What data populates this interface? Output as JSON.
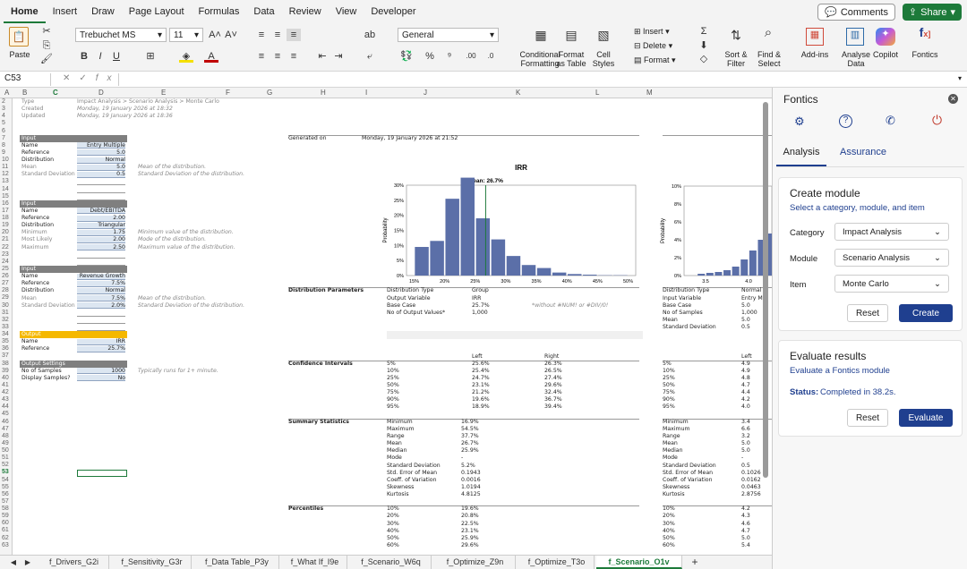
{
  "menu": {
    "items": [
      "Home",
      "Insert",
      "Draw",
      "Page Layout",
      "Formulas",
      "Data",
      "Review",
      "View",
      "Developer"
    ],
    "comments": "Comments",
    "share": "Share"
  },
  "ribbon": {
    "paste": "Paste",
    "font": "Trebuchet MS",
    "size": "11",
    "number_format": "General",
    "insert": "Insert",
    "delete": "Delete",
    "format": "Format",
    "conditional": [
      "Conditional",
      "Formatting"
    ],
    "format_table": [
      "Format",
      "as Table"
    ],
    "cell_styles": [
      "Cell",
      "Styles"
    ],
    "sort": [
      "Sort &",
      "Filter"
    ],
    "find": [
      "Find &",
      "Select"
    ],
    "addins": "Add-ins",
    "analyse": [
      "Analyse",
      "Data"
    ],
    "copilot": "Copilot",
    "fontics": "Fontics"
  },
  "formula_bar": {
    "name_box": "C53",
    "value": ""
  },
  "columns": [
    "A",
    "B",
    "C",
    "D",
    "E",
    "F",
    "G",
    "H",
    "I",
    "J",
    "K",
    "L",
    "M"
  ],
  "rows": [
    "2",
    "3",
    "4",
    "5",
    "6",
    "7",
    "8",
    "9",
    "10",
    "11",
    "12",
    "13",
    "14",
    "15",
    "16",
    "17",
    "18",
    "19",
    "20",
    "21",
    "22",
    "23",
    "24",
    "25",
    "26",
    "27",
    "28",
    "29",
    "30",
    "31",
    "32",
    "33",
    "34",
    "35",
    "36",
    "37",
    "38",
    "39",
    "40",
    "41",
    "42",
    "43",
    "44",
    "45",
    "46",
    "47",
    "48",
    "49",
    "50",
    "51",
    "52",
    "53",
    "54",
    "55",
    "56",
    "57",
    "58",
    "59",
    "60",
    "61",
    "62",
    "63"
  ],
  "meta": {
    "type_label": "Type",
    "type_value": "Impact Analysis > Scenario Analysis > Monte Carlo",
    "created_label": "Created",
    "created_value": "Monday, 19 January 2026 at 18:32",
    "updated_label": "Updated",
    "updated_value": "Monday, 19 January 2026 at 18:36"
  },
  "inputs": [
    {
      "header": "Input",
      "rows": [
        [
          "Name",
          "Entry Multiple"
        ],
        [
          "Reference",
          "5.0"
        ],
        [
          "Distribution",
          "Normal"
        ],
        [
          "Mean",
          "5.0"
        ],
        [
          "Standard Deviation",
          "0.5"
        ]
      ],
      "notes": [
        "",
        "",
        "",
        "Mean of the distribution.",
        "Standard Deviation of the distribution."
      ]
    },
    {
      "header": "Input",
      "rows": [
        [
          "Name",
          "Debt/EBITDA"
        ],
        [
          "Reference",
          "2.00"
        ],
        [
          "Distribution",
          "Triangular"
        ],
        [
          "Minimum",
          "1.75"
        ],
        [
          "Most Likely",
          "2.00"
        ],
        [
          "Maximum",
          "2.50"
        ]
      ],
      "notes": [
        "",
        "",
        "",
        "Minimum value of the distribution.",
        "Mode of the distribution.",
        "Maximum value of the distribution."
      ]
    },
    {
      "header": "Input",
      "rows": [
        [
          "Name",
          "Revenue Growth"
        ],
        [
          "Reference",
          "7.5%"
        ],
        [
          "Distribution",
          "Normal"
        ],
        [
          "Mean",
          "7.5%"
        ],
        [
          "Standard Deviation",
          "2.0%"
        ]
      ],
      "notes": [
        "",
        "",
        "",
        "Mean of the distribution.",
        "Standard Deviation of the distribution."
      ]
    }
  ],
  "output": {
    "header": "Output",
    "rows": [
      [
        "Name",
        "IRR"
      ],
      [
        "Reference",
        "25.7%"
      ]
    ]
  },
  "settings": {
    "header": "Output Settings",
    "rows": [
      [
        "No of Samples",
        "1000"
      ],
      [
        "Display Samples?",
        "No"
      ]
    ],
    "note": "Typically runs for 1+ minute."
  },
  "results": {
    "generated_label": "Generated on",
    "generated_value": "Monday, 19 January 2026 at 21:52",
    "dist_params_label": "Distribution Parameters",
    "dist_params": [
      [
        "Distribution Type",
        "Group"
      ],
      [
        "Output Variable",
        "IRR"
      ],
      [
        "Base Case",
        "25.7%"
      ],
      [
        "No of Output Values*",
        "1,000"
      ]
    ],
    "dist_note": "*without #NUM! or #DIV/0!",
    "conf_label": "Confidence Intervals",
    "left": "Left",
    "right": "Right",
    "conf": [
      [
        "5%",
        "25.6%",
        "26.3%"
      ],
      [
        "10%",
        "25.4%",
        "26.5%"
      ],
      [
        "25%",
        "24.7%",
        "27.4%"
      ],
      [
        "50%",
        "23.1%",
        "29.6%"
      ],
      [
        "75%",
        "21.2%",
        "32.4%"
      ],
      [
        "90%",
        "19.6%",
        "36.7%"
      ],
      [
        "95%",
        "18.9%",
        "39.4%"
      ]
    ],
    "summary_label": "Summary Statistics",
    "summary": [
      [
        "Minimum",
        "16.9%"
      ],
      [
        "Maximum",
        "54.5%"
      ],
      [
        "Range",
        "37.7%"
      ],
      [
        "Mean",
        "26.7%"
      ],
      [
        "Median",
        "25.9%"
      ],
      [
        "Mode",
        "-"
      ],
      [
        "Standard Deviation",
        "5.2%"
      ],
      [
        "Std. Error of Mean",
        "0.1943"
      ],
      [
        "Coeff. of Variation",
        "0.0016"
      ],
      [
        "Skewness",
        "1.0194"
      ],
      [
        "Kurtosis",
        "4.8125"
      ]
    ],
    "pct_label": "Percentiles",
    "pct": [
      [
        "10%",
        "19.6%"
      ],
      [
        "20%",
        "20.8%"
      ],
      [
        "30%",
        "22.5%"
      ],
      [
        "40%",
        "23.1%"
      ],
      [
        "50%",
        "25.9%"
      ],
      [
        "60%",
        "29.6%"
      ]
    ]
  },
  "results2": {
    "dist_params": [
      [
        "Distribution Type",
        "Normal"
      ],
      [
        "Input Variable",
        "Entry Mu"
      ],
      [
        "Base Case",
        "5.0"
      ],
      [
        "No of Samples",
        "1,000"
      ],
      [
        "Mean",
        "5.0"
      ],
      [
        "Standard Deviation",
        "0.5"
      ]
    ],
    "left": "Left",
    "conf": [
      [
        "5%",
        "4.9"
      ],
      [
        "10%",
        "4.9"
      ],
      [
        "25%",
        "4.8"
      ],
      [
        "50%",
        "4.7"
      ],
      [
        "75%",
        "4.4"
      ],
      [
        "90%",
        "4.2"
      ],
      [
        "95%",
        "4.0"
      ]
    ],
    "summary": [
      [
        "Minimum",
        "3.4"
      ],
      [
        "Maximum",
        "6.6"
      ],
      [
        "Range",
        "3.2"
      ],
      [
        "Mean",
        "5.0"
      ],
      [
        "Median",
        "5.0"
      ],
      [
        "Mode",
        "-"
      ],
      [
        "Standard Deviation",
        "0.5"
      ],
      [
        "Std. Error of Mean",
        "0.1026"
      ],
      [
        "Coeff. of Variation",
        "0.0162"
      ],
      [
        "Skewness",
        "0.0463"
      ],
      [
        "Kurtosis",
        "2.8756"
      ]
    ],
    "pct": [
      [
        "10%",
        "4.2"
      ],
      [
        "20%",
        "4.3"
      ],
      [
        "30%",
        "4.6"
      ],
      [
        "40%",
        "4.7"
      ],
      [
        "50%",
        "5.0"
      ],
      [
        "60%",
        "5.4"
      ]
    ]
  },
  "chart_data": [
    {
      "type": "bar",
      "title": "IRR",
      "annotation": "Mean: 26.7%",
      "ylabel": "Probability",
      "xlabel": "",
      "x_ticks": [
        "15%",
        "20%",
        "25%",
        "30%",
        "35%",
        "40%",
        "45%",
        "50%"
      ],
      "y_ticks": [
        "0%",
        "5%",
        "10%",
        "15%",
        "20%",
        "25%",
        "30%"
      ],
      "ylim": [
        0,
        0.3
      ],
      "bin_centers": [
        16.25,
        18.75,
        21.25,
        23.75,
        26.25,
        28.75,
        31.25,
        33.75,
        36.25,
        38.75,
        41.25,
        43.75,
        46.25,
        48.75
      ],
      "values": [
        0.095,
        0.115,
        0.255,
        0.325,
        0.19,
        0.12,
        0.065,
        0.035,
        0.025,
        0.01,
        0.005,
        0.003,
        0.001,
        0.001
      ],
      "mean_line": 26.7,
      "xlim": [
        13.75,
        51.25
      ],
      "bar_color": "#5b6fa8"
    },
    {
      "type": "bar",
      "title": "",
      "ylabel": "Probability",
      "xlabel": "",
      "x_ticks": [
        "3.5",
        "4.0"
      ],
      "y_ticks": [
        "0%",
        "2%",
        "4%",
        "6%",
        "8%",
        "10%"
      ],
      "ylim": [
        0,
        0.1
      ],
      "bin_centers": [
        3.45,
        3.55,
        3.65,
        3.75,
        3.85,
        3.95,
        4.05,
        4.15,
        4.25
      ],
      "values": [
        0.002,
        0.003,
        0.004,
        0.006,
        0.01,
        0.018,
        0.028,
        0.04,
        0.047
      ],
      "xlim": [
        3.25,
        4.27
      ],
      "bar_color": "#5b6fa8"
    }
  ],
  "tabs": [
    "f_Drivers_G2i",
    "f_Sensitivity_G3r",
    "f_Data Table_P3y",
    "f_What If_I9e",
    "f_Scenario_W6q",
    "f_Optimize_Z9n",
    "f_Optimize_T3o",
    "f_Scenario_O1v"
  ],
  "active_tab": "f_Scenario_O1v",
  "pane": {
    "title": "Fontics",
    "tabs": [
      "Analysis",
      "Assurance"
    ],
    "create": {
      "title": "Create module",
      "subtitle": "Select a category, module, and item",
      "fields": [
        {
          "label": "Category",
          "value": "Impact Analysis"
        },
        {
          "label": "Module",
          "value": "Scenario Analysis"
        },
        {
          "label": "Item",
          "value": "Monte Carlo"
        }
      ],
      "reset": "Reset",
      "submit": "Create"
    },
    "evaluate": {
      "title": "Evaluate results",
      "subtitle": "Evaluate a Fontics module",
      "status_label": "Status:",
      "status_value": "Completed in 38.2s.",
      "reset": "Reset",
      "submit": "Evaluate"
    },
    "colors": {
      "accent": "#1f3f8f",
      "link": "#1f3f8f"
    }
  }
}
